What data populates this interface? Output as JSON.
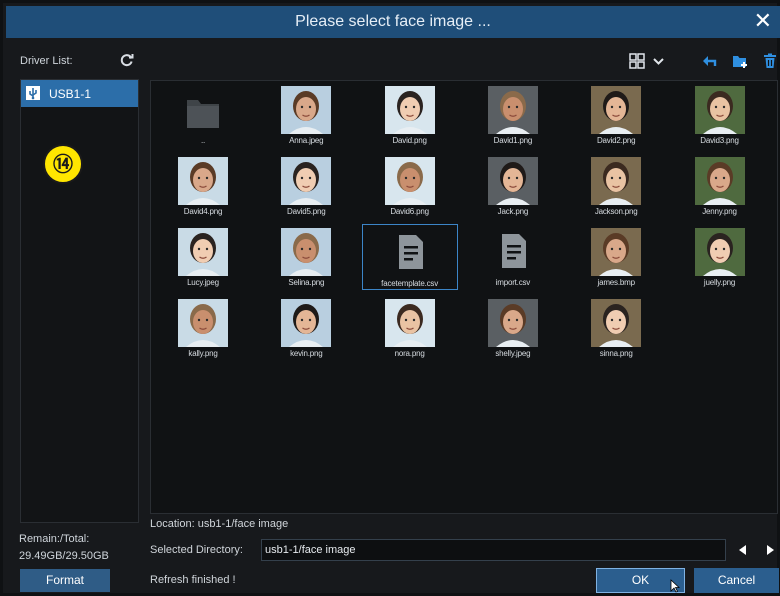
{
  "dialog": {
    "title": "Please select face image ...",
    "close_icon": "close-icon"
  },
  "sidebar": {
    "driver_list_label": "Driver List:",
    "drives": [
      {
        "label": "USB1-1",
        "icon": "usb-icon",
        "selected": true
      }
    ],
    "annotation_badge": "⑭",
    "remain_label": "Remain:/Total:",
    "remain_value": "29.49GB/29.50GB",
    "format_label": "Format"
  },
  "toolbar": {
    "icons": [
      "view-grid-icon",
      "chevron-down-icon",
      "back-icon",
      "new-folder-icon",
      "delete-icon"
    ]
  },
  "files": [
    {
      "name": "..",
      "type": "folder"
    },
    {
      "name": "Anna.jpeg",
      "type": "face"
    },
    {
      "name": "David.png",
      "type": "face"
    },
    {
      "name": "David1.png",
      "type": "face"
    },
    {
      "name": "David2.png",
      "type": "face"
    },
    {
      "name": "David3.png",
      "type": "face"
    },
    {
      "name": "David4.png",
      "type": "face"
    },
    {
      "name": "David5.png",
      "type": "face"
    },
    {
      "name": "David6.png",
      "type": "face"
    },
    {
      "name": "Jack.png",
      "type": "face"
    },
    {
      "name": "Jackson.png",
      "type": "face"
    },
    {
      "name": "Jenny.png",
      "type": "face"
    },
    {
      "name": "Lucy.jpeg",
      "type": "face"
    },
    {
      "name": "Selina.png",
      "type": "face"
    },
    {
      "name": "facetemplate.csv",
      "type": "file",
      "selected": true
    },
    {
      "name": "import.csv",
      "type": "file"
    },
    {
      "name": "james.bmp",
      "type": "face"
    },
    {
      "name": "juelly.png",
      "type": "face"
    },
    {
      "name": "kally.png",
      "type": "face"
    },
    {
      "name": "kevin.png",
      "type": "face"
    },
    {
      "name": "nora.png",
      "type": "face"
    },
    {
      "name": "shelly.jpeg",
      "type": "face"
    },
    {
      "name": "sinna.png",
      "type": "face"
    }
  ],
  "footer": {
    "location": "Location: usb1-1/face image",
    "selected_directory_label": "Selected Directory:",
    "selected_directory_value": "usb1-1/face image",
    "status": "Refresh finished !",
    "ok_label": "OK",
    "cancel_label": "Cancel"
  },
  "colors": {
    "title_bar": "#1f4e79",
    "accent": "#2c6ea9",
    "selection_border": "#3c85c8",
    "badge": "#ffe600"
  }
}
